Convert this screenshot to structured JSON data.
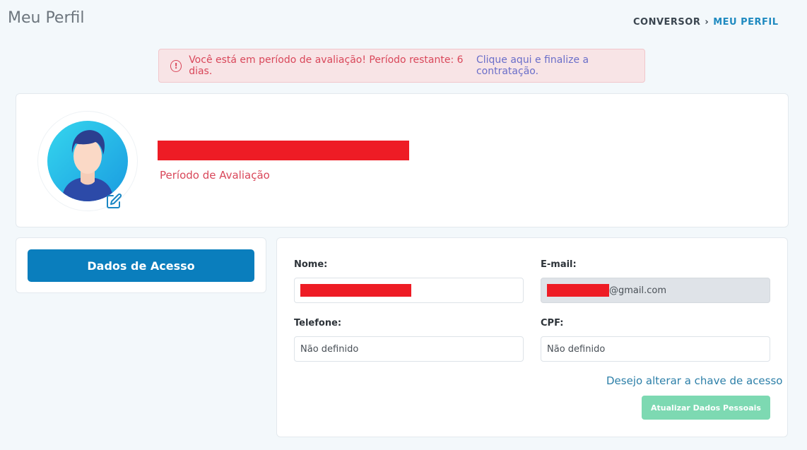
{
  "header": {
    "title": "Meu Perfil",
    "breadcrumb_root": "CONVERSOR",
    "breadcrumb_sep": "›",
    "breadcrumb_current": "MEU PERFIL"
  },
  "alert": {
    "icon": "info-circle-icon",
    "text": "Você está em período de avaliação! Período restante: 6 dias.",
    "link_text": "Clique aqui e finalize a contratação."
  },
  "profile": {
    "plan_label": "Período de Avaliação"
  },
  "sidebar": {
    "access_button_label": "Dados de Acesso"
  },
  "form": {
    "name_label": "Nome:",
    "email_label": "E-mail:",
    "email_suffix": "@gmail.com",
    "phone_label": "Telefone:",
    "phone_value": "Não definido",
    "cpf_label": "CPF:",
    "cpf_value": "Não definido",
    "change_key_link": "Desejo alterar a chave de acesso",
    "update_button_label": "Atualizar Dados Pessoais"
  },
  "colors": {
    "primary": "#0a7ebd",
    "alert_text": "#d9475a",
    "alert_bg": "#f8e4e6",
    "success_disabled": "#7dd9b2",
    "redaction": "#ee1c25"
  }
}
